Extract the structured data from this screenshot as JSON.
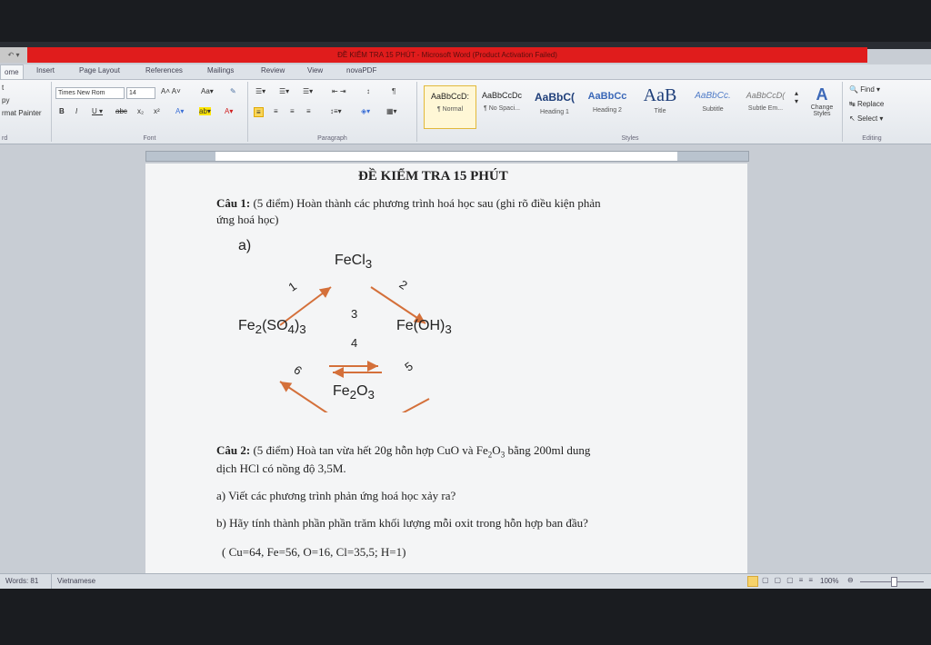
{
  "window": {
    "title": "ĐỀ KIỂM TRA 15 PHÚT - Microsoft Word (Product Activation Failed)"
  },
  "tabs": [
    "ome",
    "Insert",
    "Page Layout",
    "References",
    "Mailings",
    "Review",
    "View",
    "novaPDF"
  ],
  "ribbon": {
    "clipboard": {
      "items": [
        "t",
        "py",
        "rmat Painter"
      ],
      "label": "rd"
    },
    "font": {
      "name": "Times New Rom",
      "size": "14",
      "label": "Font"
    },
    "paragraph": {
      "label": "Paragraph"
    },
    "styles": {
      "label": "Styles",
      "items": [
        {
          "sample": "AaBbCcD:",
          "name": "¶ Normal"
        },
        {
          "sample": "AaBbCcDc",
          "name": "¶ No Spaci..."
        },
        {
          "sample": "AaBbC(",
          "name": "Heading 1"
        },
        {
          "sample": "AaBbCc",
          "name": "Heading 2"
        },
        {
          "sample": "AaB",
          "name": "Title"
        },
        {
          "sample": "AaBbCc.",
          "name": "Subtitle"
        },
        {
          "sample": "AaBbCcD(",
          "name": "Subtle Em..."
        }
      ],
      "change": "Change Styles"
    },
    "editing": {
      "find": "Find",
      "replace": "Replace",
      "select": "Select",
      "label": "Editing"
    }
  },
  "document": {
    "title": "ĐỀ KIỂM TRA 15 PHÚT",
    "q1_label": "Câu 1:",
    "q1_text": "(5 điểm) Hoàn thành các phương trình hoá học sau (ghi rõ điều kiện phản",
    "q1_text2": "ứng hoá học)",
    "diagram": {
      "part": "a)",
      "top": "FeCl",
      "top_sub": "3",
      "left": "Fe",
      "left_sub1": "2",
      "left_mid": "(SO",
      "left_sub2": "4",
      "left_end": ")",
      "left_sub3": "3",
      "right": "Fe(OH)",
      "right_sub": "3",
      "bottom": "Fe",
      "bottom_sub1": "2",
      "bottom_mid": "O",
      "bottom_sub2": "3",
      "arrows": [
        "1",
        "2",
        "3",
        "4",
        "5",
        "6"
      ]
    },
    "q2_label": "Câu 2:",
    "q2_text_a": "(5 điểm) Hoà tan vừa hết 20g hỗn hợp CuO và Fe",
    "q2_text_b": "O",
    "q2_text_c": "bằng 200ml dung",
    "q2_sub1": "2",
    "q2_sub2": "3",
    "q2_line2": "dịch HCl có nồng độ 3,5M.",
    "qa": "a) Viết các phương trình phản ứng hoá học xảy ra?",
    "qb": "b) Hãy tính thành phần phần trăm khối lượng mỗi oxit trong hỗn hợp ban đầu?",
    "atoms": "( Cu=64, Fe=56, O=16, Cl=35,5; H=1)"
  },
  "status": {
    "words": "Words: 81",
    "language": "Vietnamese",
    "zoom": "100%"
  }
}
